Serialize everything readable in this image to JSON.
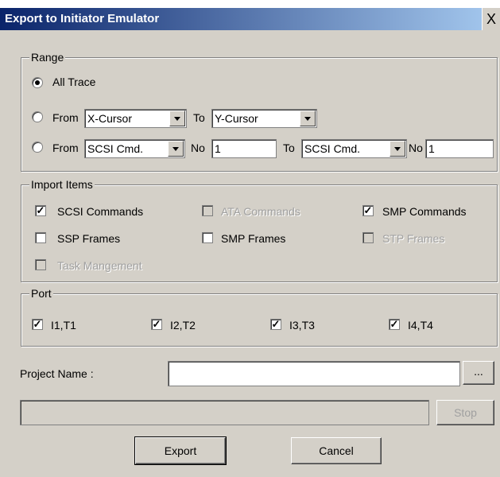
{
  "window": {
    "title": "Export to Initiator Emulator",
    "close_label": "X"
  },
  "range": {
    "legend": "Range",
    "all_trace": {
      "label": "All Trace",
      "selected": true
    },
    "from_cursor": {
      "from_label": "From",
      "from_value": "X-Cursor",
      "to_label": "To",
      "to_value": "Y-Cursor",
      "selected": false
    },
    "from_cmd": {
      "from_label": "From",
      "from_value": "SCSI Cmd.",
      "no_label": "No",
      "no_value": "1",
      "to_label": "To",
      "to_value": "SCSI Cmd.",
      "no2_label": "No",
      "no2_value": "1",
      "selected": false
    }
  },
  "import_items": {
    "legend": "Import Items",
    "items": [
      {
        "label": "SCSI Commands",
        "checked": true,
        "enabled": true
      },
      {
        "label": "ATA Commands",
        "checked": false,
        "enabled": false
      },
      {
        "label": "SMP Commands",
        "checked": true,
        "enabled": true
      },
      {
        "label": "SSP Frames",
        "checked": false,
        "enabled": true
      },
      {
        "label": "SMP Frames",
        "checked": false,
        "enabled": true
      },
      {
        "label": "STP Frames",
        "checked": false,
        "enabled": false
      },
      {
        "label": "Task Mangement",
        "checked": false,
        "enabled": false
      }
    ]
  },
  "port": {
    "legend": "Port",
    "items": [
      {
        "label": "I1,T1",
        "checked": true
      },
      {
        "label": "I2,T2",
        "checked": true
      },
      {
        "label": "I3,T3",
        "checked": true
      },
      {
        "label": "I4,T4",
        "checked": true
      }
    ]
  },
  "project": {
    "label": "Project Name :",
    "value": "",
    "browse_label": "..."
  },
  "progress": {
    "value": 0,
    "stop_label": "Stop"
  },
  "buttons": {
    "export_label": "Export",
    "cancel_label": "Cancel"
  }
}
